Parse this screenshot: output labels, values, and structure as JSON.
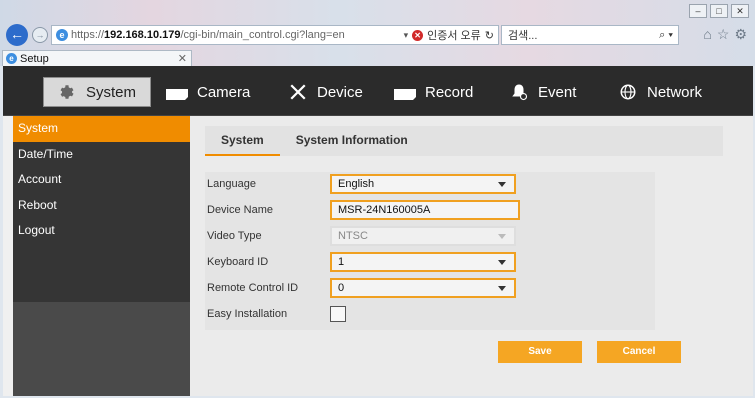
{
  "browser": {
    "url_prefix": "https://",
    "url_host": "192.168.10.179",
    "url_path": "/cgi-bin/main_control.cgi?lang=en",
    "cert_error": "인증서 오류",
    "search_placeholder": "검색...",
    "tab_title": "Setup"
  },
  "topnav": {
    "items": [
      {
        "label": "System",
        "icon": "gear-icon"
      },
      {
        "label": "Camera",
        "icon": "camera-icon"
      },
      {
        "label": "Device",
        "icon": "tools-icon"
      },
      {
        "label": "Record",
        "icon": "record-icon"
      },
      {
        "label": "Event",
        "icon": "bell-icon"
      },
      {
        "label": "Network",
        "icon": "globe-icon"
      }
    ]
  },
  "sidebar": {
    "items": [
      {
        "label": "System"
      },
      {
        "label": "Date/Time"
      },
      {
        "label": "Account"
      },
      {
        "label": "Reboot"
      },
      {
        "label": "Logout"
      }
    ]
  },
  "subtabs": {
    "items": [
      {
        "label": "System"
      },
      {
        "label": "System Information"
      }
    ]
  },
  "form": {
    "language_label": "Language",
    "language_value": "English",
    "device_name_label": "Device Name",
    "device_name_value": "MSR-24N160005A",
    "video_type_label": "Video Type",
    "video_type_value": "NTSC",
    "keyboard_id_label": "Keyboard ID",
    "keyboard_id_value": "1",
    "remote_control_id_label": "Remote Control ID",
    "remote_control_id_value": "0",
    "easy_install_label": "Easy Installation"
  },
  "buttons": {
    "save": "Save",
    "cancel": "Cancel"
  },
  "colors": {
    "accent": "#f08c00",
    "button": "#f5a623",
    "nav_bg": "#2b2b2b",
    "sidebar_bg": "#353535"
  }
}
